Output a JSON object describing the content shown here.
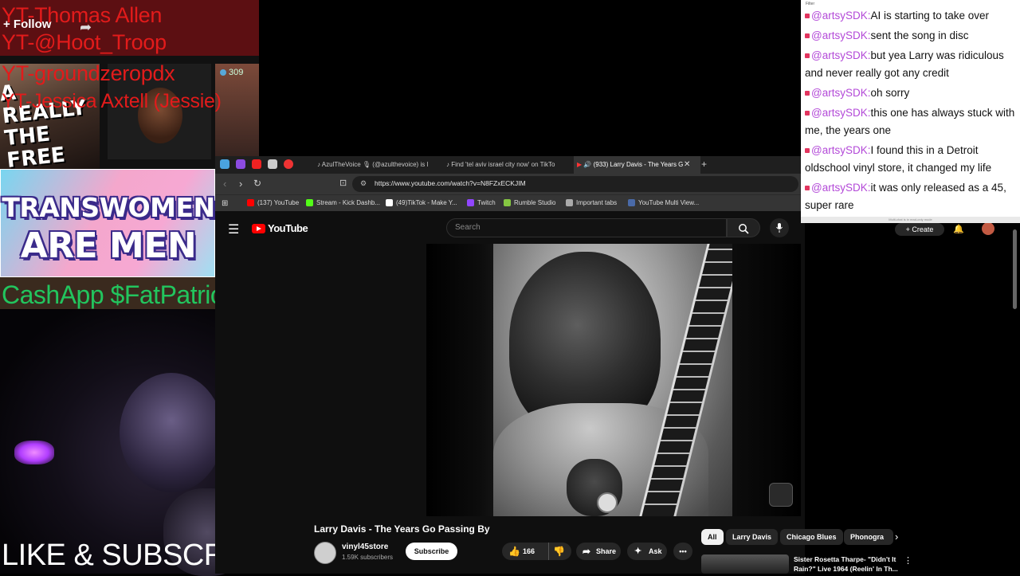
{
  "overlay": {
    "follow_label": "+ Follow",
    "viewer_count": "309",
    "thumb_text": "A REALLY THE FREE",
    "yt_names": [
      "YT-Thomas Allen",
      "YT-@Hoot_Troop",
      "YT-groundzeropdx",
      "YT-Jessica Axtell (Jessie)"
    ],
    "banner_line1": "TRANSWOMEN",
    "banner_line2": "ARE MEN",
    "cashapp": "CashApp $FatPatriot",
    "like_subscribe": "LIKE & SUBSCRIBE"
  },
  "browser": {
    "tabs": [
      {
        "label": "AzulTheVoice 🎙 (@azulthevoice) is l"
      },
      {
        "label": "Find 'tel aviv israel city now' on TikTo"
      },
      {
        "label": "(933) Larry Davis - The Years G"
      }
    ],
    "url": "https://www.youtube.com/watch?v=N8FZxECKJIM",
    "bookmarks": [
      {
        "label": "(137) YouTube",
        "color": "#ff0000"
      },
      {
        "label": "Stream - Kick Dashb...",
        "color": "#53fc18"
      },
      {
        "label": "(49)TikTok - Make Y...",
        "color": "#ffffff"
      },
      {
        "label": "Twitch",
        "color": "#9146ff"
      },
      {
        "label": "Rumble Studio",
        "color": "#85c742"
      },
      {
        "label": "Important tabs",
        "color": "#aaaaaa"
      },
      {
        "label": "YouTube Multi View...",
        "color": "#4a6aa8"
      }
    ]
  },
  "youtube": {
    "logo_text": "YouTube",
    "search_placeholder": "Search",
    "create_label": "+ Create",
    "video_title": "Larry Davis - The Years Go Passing By",
    "channel_name": "vinyl45store",
    "channel_subs": "1.59K subscribers",
    "subscribe_label": "Subscribe",
    "like_count": "166",
    "share_label": "Share",
    "ask_label": "Ask",
    "chips": [
      "All",
      "Larry Davis",
      "Chicago Blues",
      "Phonogra"
    ],
    "recommended": {
      "title": "Sister Rosetta Tharpe- \"Didn't It Rain?\" Live 1964 (Reelin' In Th..."
    }
  },
  "chat": {
    "filter_label": "Filter",
    "messages": [
      {
        "user": "@artsySDK:",
        "text": "AI is starting to take over"
      },
      {
        "user": "@artsySDK:",
        "text": "sent the song in disc"
      },
      {
        "user": "@artsySDK:",
        "text": "but yea Larry was ridiculous and never really got any credit"
      },
      {
        "user": "@artsySDK:",
        "text": "oh sorry"
      },
      {
        "user": "@artsySDK:",
        "text": "this one has always stuck with me, the years one"
      },
      {
        "user": "@artsySDK:",
        "text": "I found this in a Detroit oldschool vinyl store, it changed my life"
      },
      {
        "user": "@artsySDK:",
        "text": "it was only released as a 45, super rare"
      }
    ],
    "footer_note": "Multi-chat is in read-only mode"
  }
}
